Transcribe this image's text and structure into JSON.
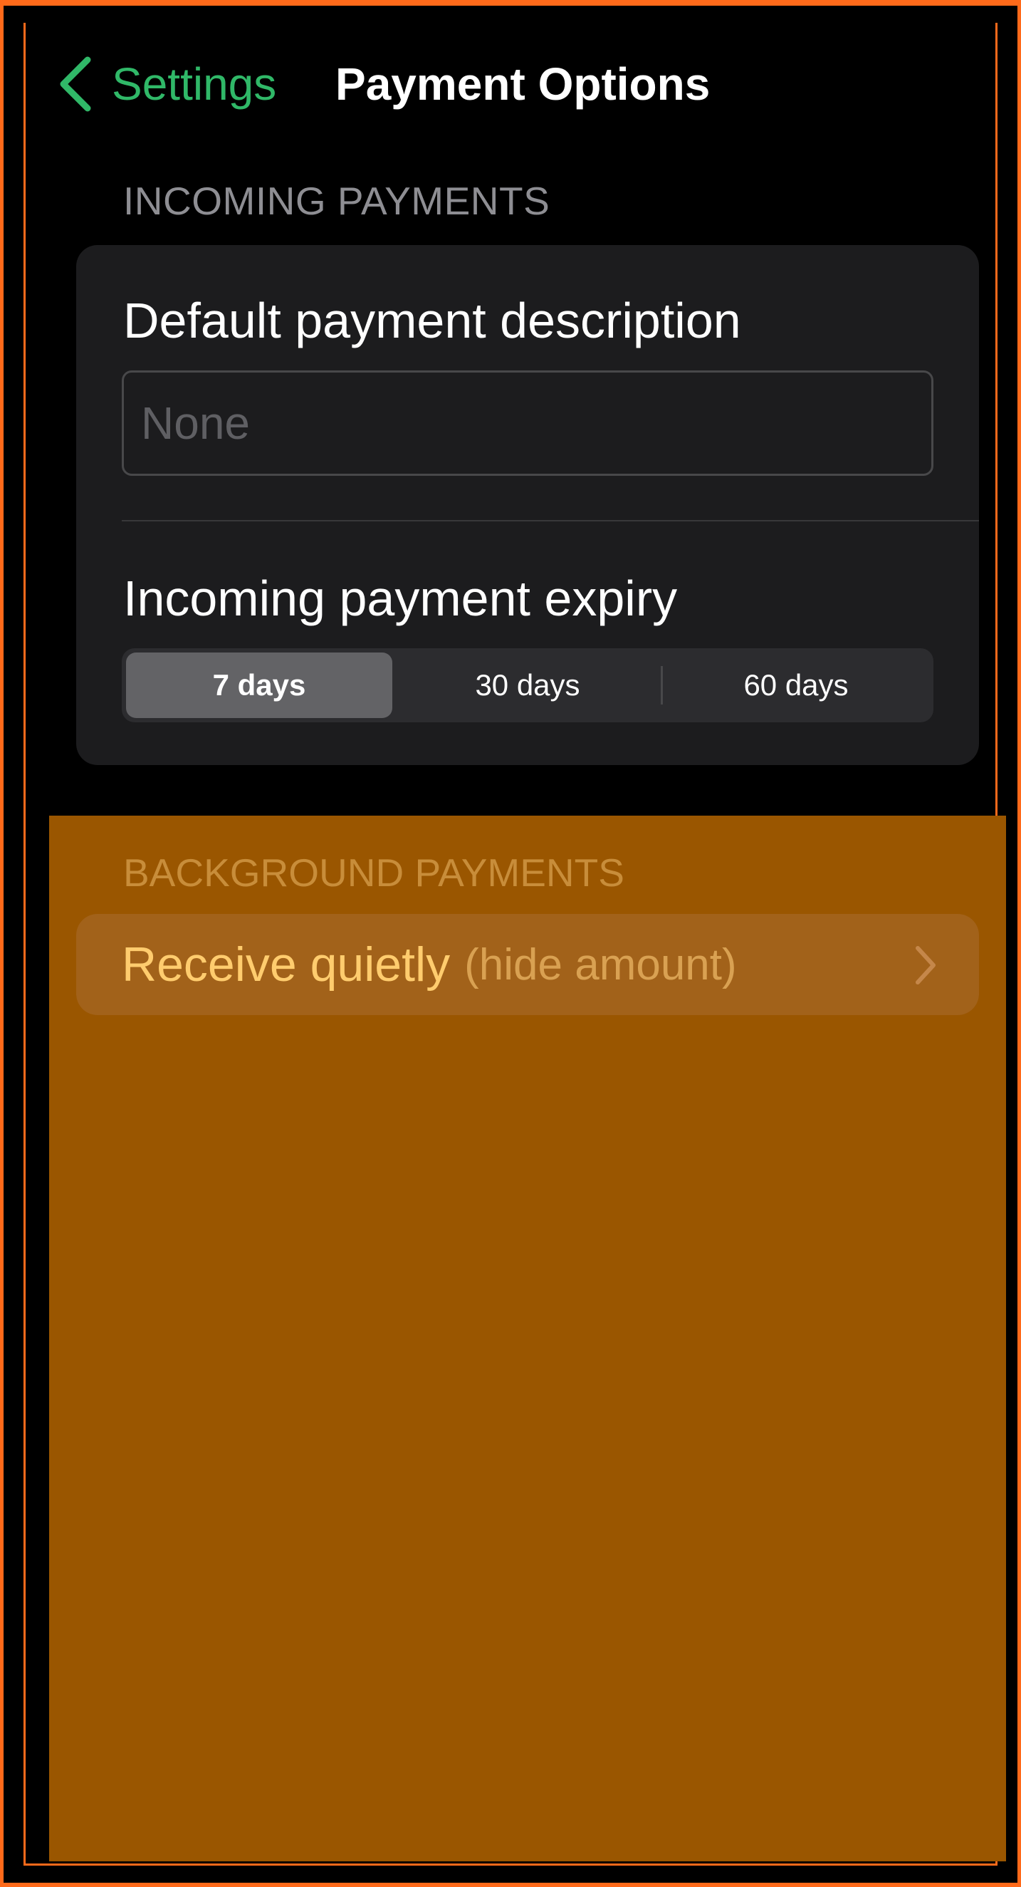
{
  "nav": {
    "back_label": "Settings",
    "title": "Payment Options"
  },
  "incoming": {
    "header": "INCOMING PAYMENTS",
    "description_label": "Default payment description",
    "description_placeholder": "None",
    "description_value": "",
    "expiry_label": "Incoming payment expiry",
    "expiry_options": [
      "7 days",
      "30 days",
      "60 days"
    ],
    "expiry_selected": "7 days"
  },
  "background": {
    "header": "BACKGROUND PAYMENTS",
    "row_title": "Receive quietly",
    "row_subtitle": "(hide amount)"
  },
  "colors": {
    "accent": "#30b868",
    "frame": "#ff6a1a",
    "overlay": "#9a5600",
    "card": "#1c1c1e"
  },
  "icons": {
    "back": "chevron-left-icon",
    "row": "chevron-right-icon"
  }
}
